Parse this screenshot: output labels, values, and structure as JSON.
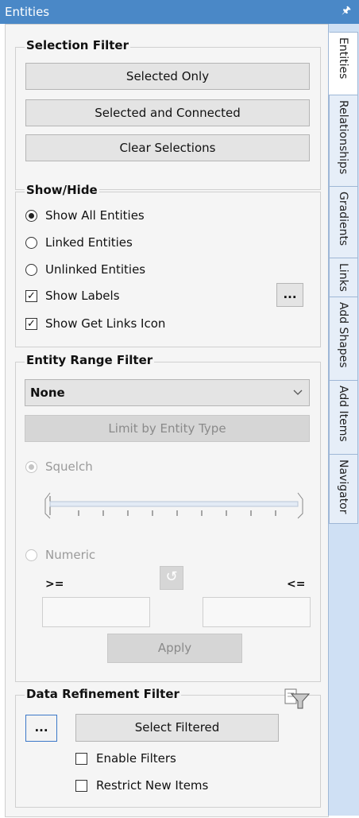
{
  "window": {
    "title": "Entities",
    "pin_icon": "pin-icon"
  },
  "tabs": [
    "Entities",
    "Relationships",
    "Gradients",
    "Links",
    "Add Shapes",
    "Add Items",
    "Navigator"
  ],
  "selection_filter": {
    "title": "Selection Filter",
    "buttons": [
      "Selected Only",
      "Selected and Connected",
      "Clear Selections"
    ]
  },
  "show_hide": {
    "title": "Show/Hide",
    "radios": [
      "Show All Entities",
      "Linked Entities",
      "Unlinked Entities"
    ],
    "selected_radio": "Show All Entities",
    "show_labels": "Show Labels",
    "show_get_links": "Show Get Links Icon",
    "ellipsis": "..."
  },
  "range_filter": {
    "title": "Entity Range Filter",
    "dropdown_value": "None",
    "limit_button": "Limit by Entity Type",
    "squelch": "Squelch",
    "numeric": "Numeric",
    "gte": ">=",
    "lte": "<=",
    "refresh_icon": "refresh-icon",
    "apply": "Apply"
  },
  "data_refinement": {
    "title": "Data Refinement Filter",
    "ellipsis": "...",
    "select_filtered": "Select Filtered",
    "enable_filters": "Enable Filters",
    "restrict_new_items": "Restrict New Items",
    "filter_icon": "funnel-icon"
  }
}
